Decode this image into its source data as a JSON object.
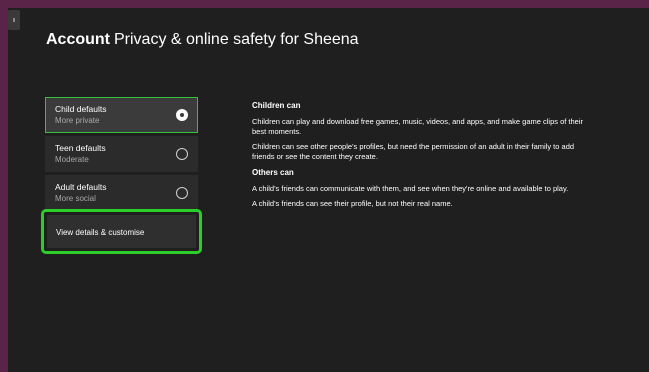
{
  "header": {
    "section": "Account",
    "title": "Privacy & online safety for Sheena"
  },
  "options": [
    {
      "label": "Child defaults",
      "sub": "More private",
      "selected": true
    },
    {
      "label": "Teen defaults",
      "sub": "Moderate",
      "selected": false
    },
    {
      "label": "Adult defaults",
      "sub": "More social",
      "selected": false
    }
  ],
  "customise": {
    "label": "View details & customise"
  },
  "info": {
    "children_heading": "Children can",
    "children_p1": "Children can play and download free games, music, videos, and apps, and make game clips of their best moments.",
    "children_p2": "Children can see other people's profiles, but need the permission of an adult in their family to add friends or see the content they create.",
    "others_heading": "Others can",
    "others_p1": "A child's friends can communicate with them, and see when they're online and available to play.",
    "others_p2": "A child's friends can see their profile, but not their real name."
  },
  "colors": {
    "frame": "#5a2348",
    "background": "#1f1f1f",
    "focus": "#2ccf2a"
  }
}
